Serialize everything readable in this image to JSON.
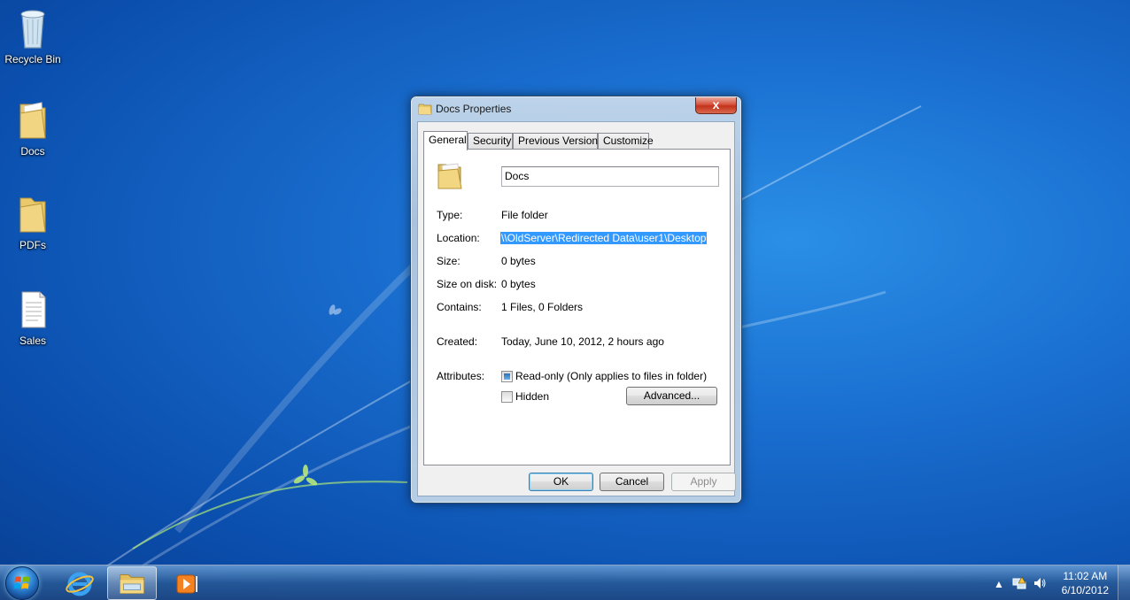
{
  "desktop": {
    "icons": [
      {
        "label": "Recycle Bin",
        "icon": "recycle-bin-icon"
      },
      {
        "label": "Docs",
        "icon": "folder-icon"
      },
      {
        "label": "PDFs",
        "icon": "folder-icon"
      },
      {
        "label": "Sales",
        "icon": "text-document-icon"
      }
    ]
  },
  "dialog": {
    "title": "Docs Properties",
    "close_label": "x",
    "tabs": [
      {
        "label": "General",
        "active": true
      },
      {
        "label": "Security",
        "active": false
      },
      {
        "label": "Previous Versions",
        "active": false
      },
      {
        "label": "Customize",
        "active": false
      }
    ],
    "name_value": "Docs",
    "properties": {
      "type_label": "Type:",
      "type_value": "File folder",
      "location_label": "Location:",
      "location_value": "\\\\OldServer\\Redirected Data\\user1\\Desktop",
      "size_label": "Size:",
      "size_value": "0 bytes",
      "size_on_disk_label": "Size on disk:",
      "size_on_disk_value": "0 bytes",
      "contains_label": "Contains:",
      "contains_value": "1 Files, 0 Folders",
      "created_label": "Created:",
      "created_value": "Today, June 10, 2012, 2 hours ago"
    },
    "attributes": {
      "label": "Attributes:",
      "readonly_label": "Read-only (Only applies to files in folder)",
      "readonly_state": "indeterminate",
      "hidden_label": "Hidden",
      "hidden_checked": false,
      "advanced_label": "Advanced..."
    },
    "buttons": {
      "ok": "OK",
      "cancel": "Cancel",
      "apply": "Apply"
    }
  },
  "taskbar": {
    "pinned": [
      "internet-explorer-icon",
      "windows-explorer-icon",
      "media-player-icon"
    ],
    "tray_icons": [
      "show-hidden-icons-arrow",
      "network-icon",
      "volume-icon"
    ],
    "clock_time": "11:02 AM",
    "clock_date": "6/10/2012"
  }
}
